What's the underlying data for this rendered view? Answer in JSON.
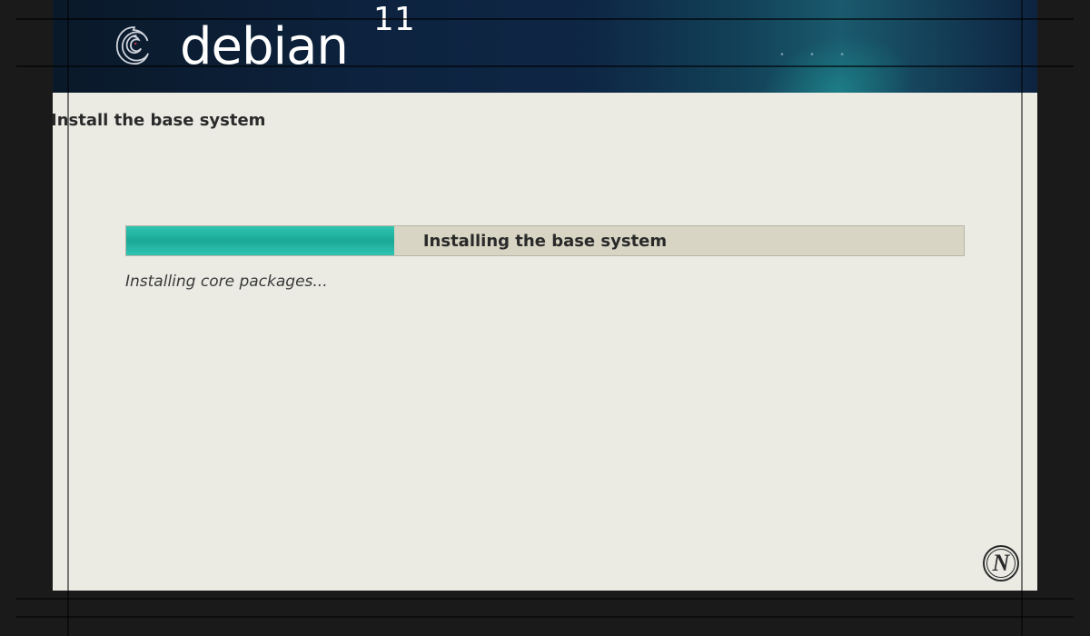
{
  "header": {
    "distro_name": "debian",
    "distro_version": "11"
  },
  "installer": {
    "step_title": "Install the base system",
    "progress": {
      "label": "Installing the base system",
      "percent": 32,
      "status_text": "Installing core packages..."
    }
  },
  "watermark": {
    "glyph": "N"
  },
  "colors": {
    "progress_fill": "#1ba896",
    "progress_track": "#d8d5c4",
    "header_bg": "#0d2340",
    "page_bg": "#ebebe4"
  }
}
